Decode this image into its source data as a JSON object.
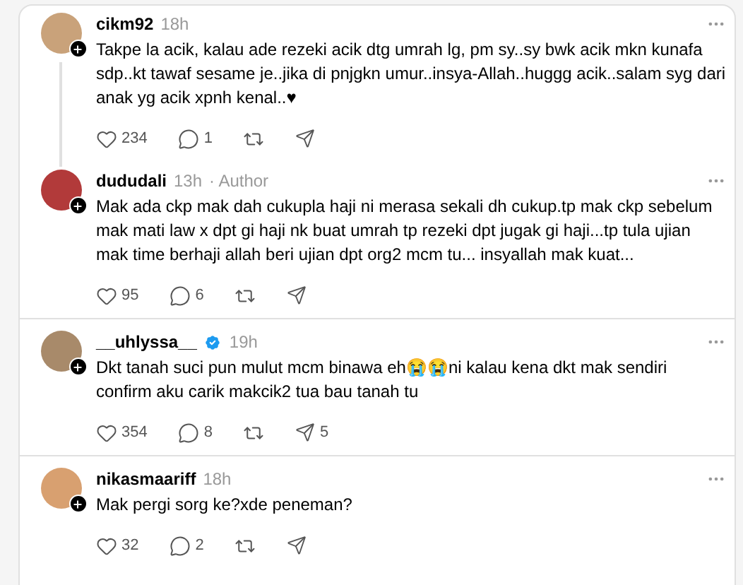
{
  "posts": [
    {
      "username": "cikm92",
      "time": "18h",
      "thread_continues": true,
      "text": "Takpe la acik, kalau ade rezeki acik dtg umrah lg, pm sy..sy bwk acik mkn kunafa sdp..kt tawaf sesame je..jika di pnjgkn umur..insya-Allah..huggg acik..salam syg dari anak yg acik xpnh kenal..♥",
      "likes": "234",
      "replies": "1"
    },
    {
      "username": "dududali",
      "time": "13h",
      "author_label": "· Author",
      "text": "Mak ada ckp mak dah cukupla haji ni merasa sekali dh cukup.tp mak ckp sebelum mak mati law x dpt gi haji nk buat umrah tp rezeki dpt jugak gi haji...tp tula ujian mak time berhaji allah beri ujian dpt org2 mcm tu... insyallah mak kuat...",
      "likes": "95",
      "replies": "6"
    },
    {
      "username": "__uhlyssa__",
      "time": "19h",
      "verified": true,
      "text": "Dkt tanah suci pun mulut mcm binawa eh😭😭ni kalau kena dkt mak sendiri confirm aku carik makcik2 tua bau tanah tu",
      "likes": "354",
      "replies": "8",
      "shares": "5"
    },
    {
      "username": "nikasmaariff",
      "time": "18h",
      "text": "Mak pergi sorg ke?xde peneman?",
      "likes": "32",
      "replies": "2"
    }
  ]
}
